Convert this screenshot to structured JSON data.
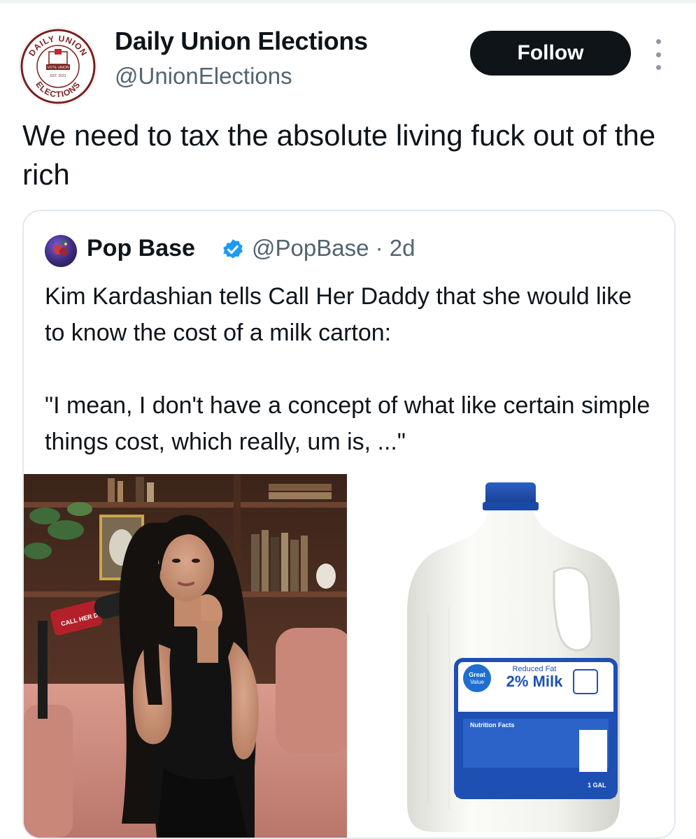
{
  "author": {
    "name": "Daily Union Elections",
    "handle": "@UnionElections",
    "avatar_text_top": "DAILY UNION",
    "avatar_text_bottom": "ELECTIONS",
    "avatar_sign": "VOTE UNION",
    "avatar_est": "EST. 2021"
  },
  "follow_label": "Follow",
  "tweet_text": "We need to tax the absolute living fuck out of the rich",
  "quoted": {
    "name": "Pop Base",
    "handle_time": "@PopBase · 2d",
    "paragraph1": "Kim Kardashian tells Call Her Daddy that she would like to know the cost of a milk carton:",
    "paragraph2": "\"I mean, I don't have a concept of what like certain simple things cost, which really, um is, ...\"",
    "verified_color": "#1d9bf0"
  },
  "media": {
    "mic_flag_text": "CALL HER DADDY",
    "milk_brand": "Great Value",
    "milk_label_line1": "Reduced Fat",
    "milk_label_line2": "2% Milk",
    "milk_size": "1 GAL (3.78 L)",
    "nutrition_heading": "Nutrition Facts"
  },
  "icons": {
    "more": "more-vertical-icon",
    "verified": "verified-badge-icon"
  }
}
